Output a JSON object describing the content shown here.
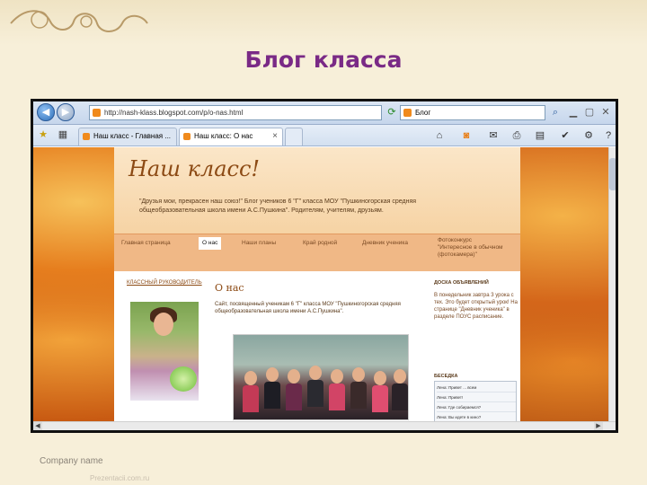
{
  "slide": {
    "title": "Блог класса",
    "company": "Company name",
    "watermark": "Prezentacii.com.ru"
  },
  "browser": {
    "address": "http://nash-klass.blogspot.com/p/o-nas.html",
    "search_text": "Блог",
    "tabs": [
      {
        "label": "Наш класс - Главная ..."
      },
      {
        "label": "Наш класс: О нас"
      }
    ],
    "tab_close": "×"
  },
  "blog": {
    "title": "Наш класс!",
    "description": "\"Друзья мои, прекрасен наш союз!\" Блог учеников 6 \"Г\" класса МОУ \"Пушкиногорская средняя общеобразовательная школа имени А.С.Пушкина\". Родителям, учителям, друзьям.",
    "menu": [
      {
        "label": "Главная страница"
      },
      {
        "label": "О нас"
      },
      {
        "label": "Наши планы"
      },
      {
        "label": "Край родной"
      },
      {
        "label": "Дневник ученика"
      },
      {
        "label": "Фотоконкурс \"Интересное в обычном (фотокамера)\""
      }
    ],
    "sidebar_left": {
      "heading": "КЛАССНЫЙ РУКОВОДИТЕЛЬ"
    },
    "post": {
      "title": "О нас",
      "text": "Сайт, посвященный ученикам 6 \"Г\" класса МОУ \"Пушкиногорская средняя общеобразовательная школа имени А.С.Пушкина\"."
    },
    "sidebar_right": {
      "heading": "ДОСКА ОБЪЯВЛЕНИЙ",
      "text": "В понедельник завтра 3 урока с тех. Это будет открытый урок! На странице \"Дневник ученика\" в разделе ПОУС расписание.",
      "chat_heading": "БЕСЕДКА",
      "chat": [
        "Лена: Привет ... всем",
        "Лена: Привет!",
        "Лена: Где собираемся?",
        "Лена: Вы идете в кино?"
      ]
    }
  },
  "colors": {
    "slide_title": "#7a2a86",
    "blog_title": "#8c4a14",
    "menu_bg": "#f0b886"
  }
}
